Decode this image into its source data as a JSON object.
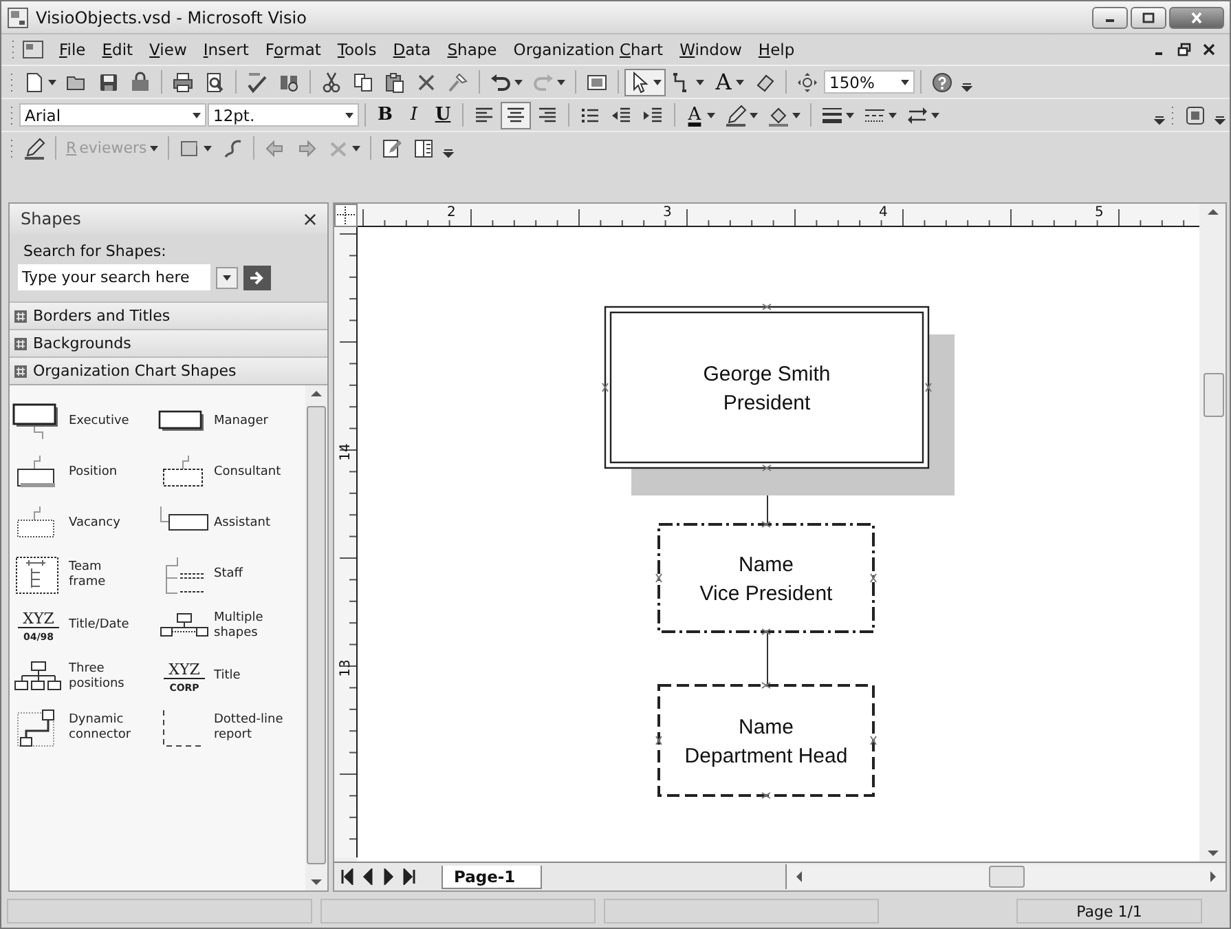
{
  "window": {
    "title": "VisioObjects.vsd - Microsoft Visio"
  },
  "menu": [
    {
      "key": "F",
      "post": "ile"
    },
    {
      "key": "E",
      "post": "dit"
    },
    {
      "key": "V",
      "post": "iew"
    },
    {
      "key": "I",
      "post": "nsert"
    },
    {
      "pre": "F",
      "key": "o",
      "post": "rmat"
    },
    {
      "key": "T",
      "post": "ools"
    },
    {
      "key": "D",
      "post": "ata"
    },
    {
      "key": "S",
      "post": "hape"
    },
    {
      "pre": "Organization ",
      "key": "C",
      "post": "hart"
    },
    {
      "key": "W",
      "post": "indow"
    },
    {
      "key": "H",
      "post": "elp"
    }
  ],
  "standard_toolbar": {
    "text_tool": "A",
    "zoom": "150%"
  },
  "formatting_toolbar": {
    "font": "Arial",
    "size": "12pt.",
    "bold": "B",
    "italic": "I",
    "underline": "U",
    "alignment": [
      {
        "selected": false
      },
      {
        "selected": true
      },
      {
        "selected": false
      }
    ],
    "font_color": "A"
  },
  "reviewing_toolbar": {
    "reviewers": {
      "key": "R",
      "post": "eviewers",
      "disabled": true
    }
  },
  "shapes_panel": {
    "title": "Shapes",
    "search_label": "Search for Shapes:",
    "search_placeholder": "Type your search here",
    "stencils": [
      "Borders and Titles",
      "Backgrounds",
      "Organization Chart Shapes"
    ],
    "shapes": [
      {
        "label": "Executive",
        "kind": "executive"
      },
      {
        "label": "Manager",
        "kind": "manager"
      },
      {
        "label": "Position",
        "kind": "position"
      },
      {
        "label": "Consultant",
        "kind": "consultant"
      },
      {
        "label": "Vacancy",
        "kind": "vacancy"
      },
      {
        "label": "Assistant",
        "kind": "assistant"
      },
      {
        "label": "Team frame",
        "kind": "team-frame"
      },
      {
        "label": "Staff",
        "kind": "staff"
      },
      {
        "label": "Title/Date",
        "kind": "title-text",
        "icon_text": [
          "XYZ",
          "04/98"
        ]
      },
      {
        "label": "Multiple shapes",
        "kind": "multiple"
      },
      {
        "label": "Three positions",
        "kind": "three"
      },
      {
        "label": "Title",
        "kind": "title-text",
        "icon_text": [
          "XYZ",
          "CORP"
        ]
      },
      {
        "label": "Dynamic connector",
        "kind": "connector"
      },
      {
        "label": "Dotted-line report",
        "kind": "dotted"
      }
    ]
  },
  "ruler": {
    "horizontal": [
      "2",
      "3",
      "4",
      "5"
    ],
    "vertical": [
      "14",
      "13"
    ]
  },
  "diagram": {
    "nodes": [
      {
        "kind": "double",
        "shadow": true,
        "lines": [
          "George Smith",
          "President"
        ]
      },
      {
        "kind": "dash-dot",
        "shadow": false,
        "lines": [
          "Name",
          "Vice President"
        ]
      },
      {
        "kind": "dashed",
        "shadow": false,
        "lines": [
          "Name",
          "Department Head"
        ]
      }
    ]
  },
  "page_tabs": [
    {
      "label": "Page-1",
      "selected": true
    }
  ],
  "status_bar": {
    "page": "Page 1/1"
  }
}
